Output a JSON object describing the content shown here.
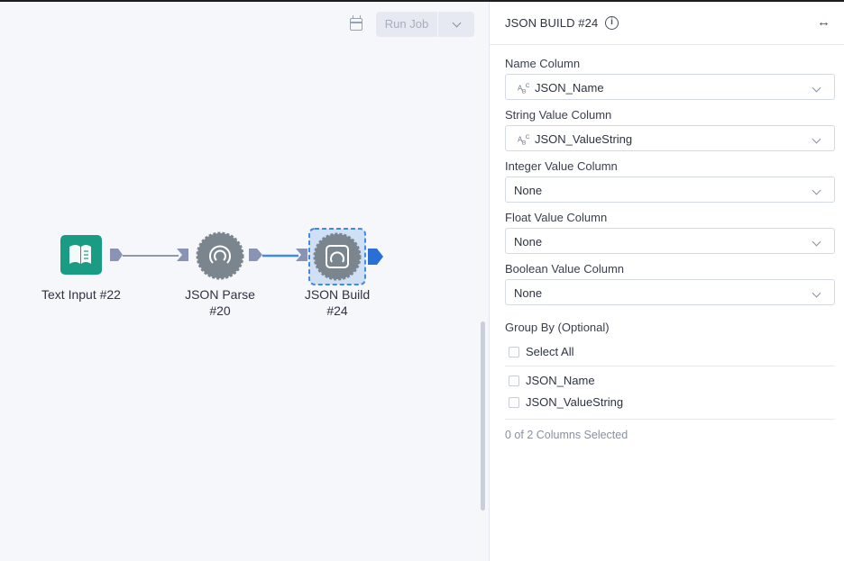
{
  "toolbar": {
    "calendar_icon": "calendar-icon",
    "run_job_label": "Run Job",
    "run_job_menu_icon": "chevron-down-icon"
  },
  "workflow": {
    "tools": [
      {
        "id": "text-input",
        "label": "Text Input #22",
        "icon": "book-icon",
        "color": "#1a9b83"
      },
      {
        "id": "json-parse",
        "label": "JSON Parse #20",
        "line1": "JSON Parse",
        "line2": "#20",
        "icon": "json-gear-icon"
      },
      {
        "id": "json-build",
        "label": "JSON Build #24",
        "line1": "JSON Build",
        "line2": "#24",
        "icon": "json-gear-icon",
        "selected": true
      }
    ],
    "colors": {
      "connector": "#8a93b3",
      "active_connector": "#3d8be8",
      "output_anchor": "#2a6fd6",
      "gear": "#7a858e"
    }
  },
  "panel": {
    "title": "JSON BUILD #24",
    "info_icon": "info-icon",
    "expand_icon": "expand-arrows-icon",
    "fields": [
      {
        "label": "Name Column",
        "value": "JSON_Name",
        "type_icon": "A B C"
      },
      {
        "label": "String Value Column",
        "value": "JSON_ValueString",
        "type_icon": "A B C"
      },
      {
        "label": "Integer Value Column",
        "value": "None"
      },
      {
        "label": "Float Value Column",
        "value": "None"
      },
      {
        "label": "Boolean Value Column",
        "value": "None"
      }
    ],
    "group_by": {
      "label": "Group By (Optional)",
      "select_all": "Select All",
      "columns": [
        "JSON_Name",
        "JSON_ValueString"
      ],
      "selection_text": "0 of 2 Columns Selected"
    }
  }
}
